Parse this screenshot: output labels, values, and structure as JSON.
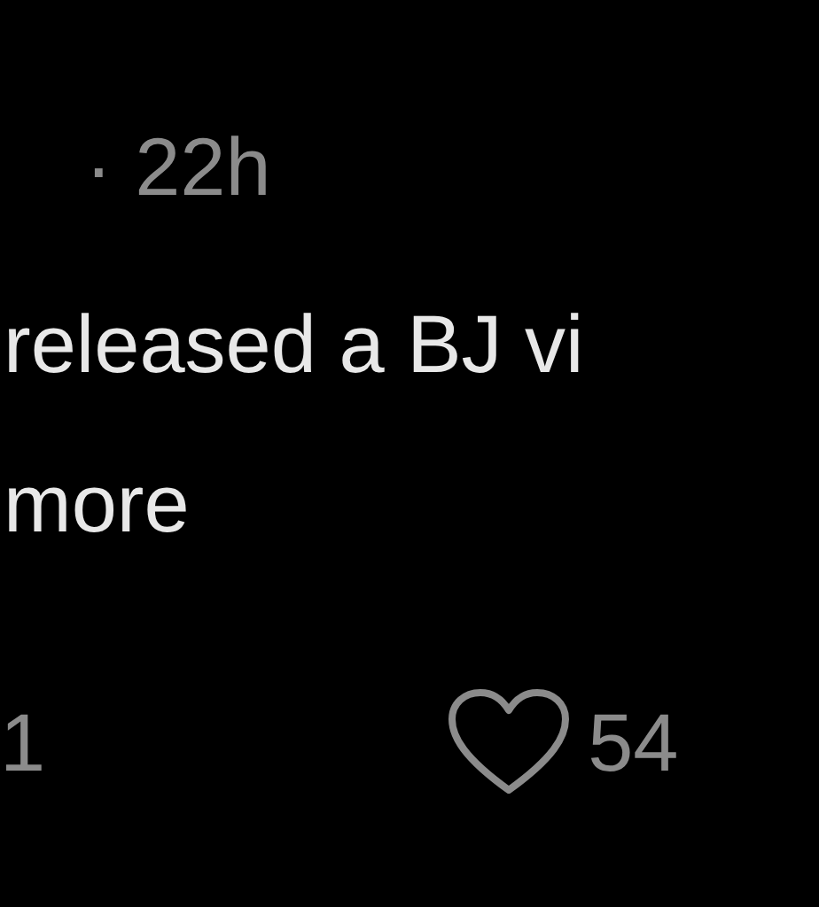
{
  "post": {
    "time": "· 22h",
    "text_lines": [
      "released a BJ vi",
      "more"
    ]
  },
  "actions": {
    "reply_count": "1",
    "like_count": "54"
  }
}
